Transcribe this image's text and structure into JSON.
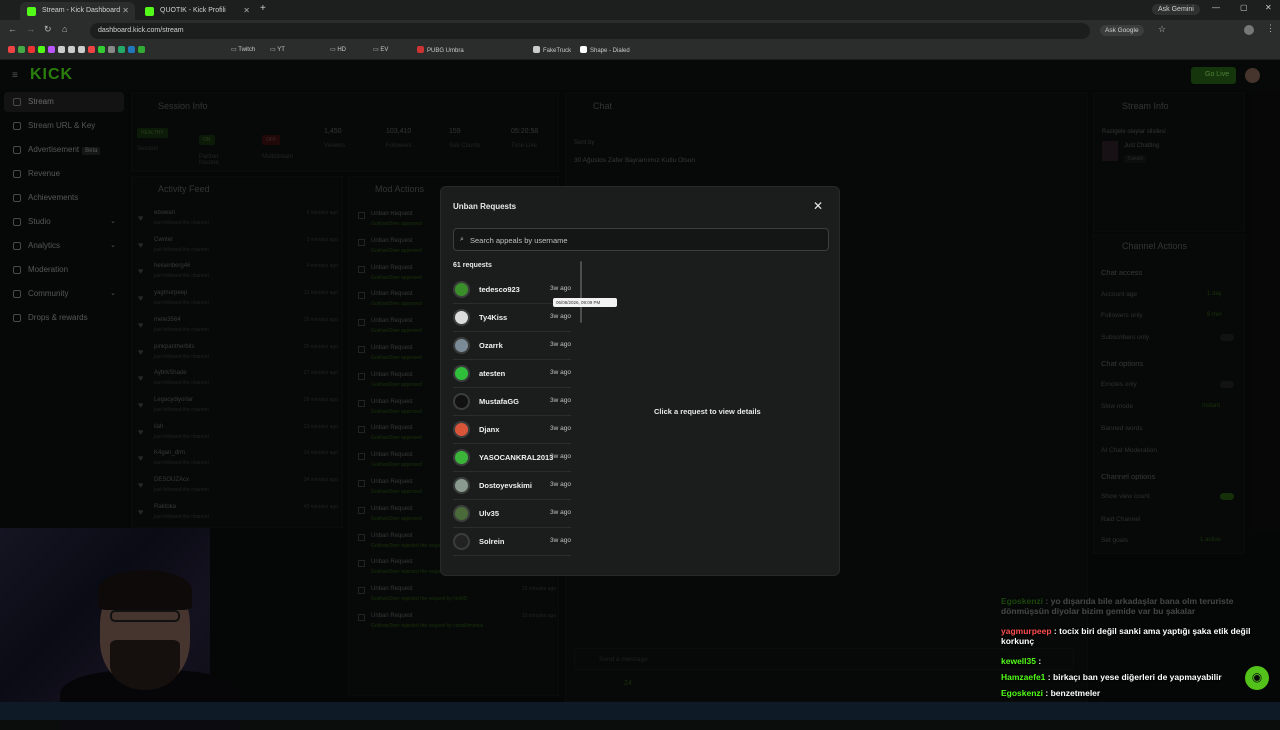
{
  "browser": {
    "tabs": [
      {
        "label": "Stream - Kick Dashboard",
        "active": true
      },
      {
        "label": "QUOTIK - Kick Profili",
        "active": false
      }
    ],
    "gemini": "Ask Gemini",
    "url": "dashboard.kick.com/stream",
    "ask_google": "Ask Google",
    "bookmarks": [
      "Twitch",
      "YT",
      "HD",
      "EV",
      "PUBG Umbra",
      "FakeTruck",
      "Shape - Dialed"
    ]
  },
  "kick": {
    "logo": "KICK",
    "go_live": "Go Live"
  },
  "sidebar": {
    "items": [
      {
        "label": "Stream",
        "active": true
      },
      {
        "label": "Stream URL & Key"
      },
      {
        "label": "Advertisement",
        "badge": "Beta"
      },
      {
        "label": "Revenue"
      },
      {
        "label": "Achievements"
      },
      {
        "label": "Studio"
      },
      {
        "label": "Analytics"
      },
      {
        "label": "Moderation"
      },
      {
        "label": "Community"
      },
      {
        "label": "Drops & rewards"
      }
    ]
  },
  "session": {
    "title": "Session Info",
    "stats": [
      {
        "value": "HEALTHY",
        "label": "Session"
      },
      {
        "value": "ON",
        "label": "Partner Income"
      },
      {
        "value": "OFF",
        "label": "Multistream"
      },
      {
        "value": "1,450",
        "label": "Viewers"
      },
      {
        "value": "103,410",
        "label": "Followers"
      },
      {
        "value": "159",
        "label": "Sub Counts"
      },
      {
        "value": "05:20:58",
        "label": "Time Live"
      }
    ]
  },
  "activity": {
    "title": "Activity Feed",
    "sub": "just followed the channel",
    "rows": [
      {
        "name": "ebowan",
        "time": "2 minutes ago"
      },
      {
        "name": "Cwnter",
        "time": "3 minutes ago"
      },
      {
        "name": "heisenberg46",
        "time": "4 minutes ago"
      },
      {
        "name": "yagmurpeep",
        "time": "12 minutes ago"
      },
      {
        "name": "mete3564",
        "time": "15 minutes ago"
      },
      {
        "name": "pinkpantherbitc",
        "time": "25 minutes ago"
      },
      {
        "name": "AybrkShade",
        "time": "27 minutes ago"
      },
      {
        "name": "Legacydiyorlar",
        "time": "28 minutes ago"
      },
      {
        "name": "ilah",
        "time": "33 minutes ago"
      },
      {
        "name": "K4gan_drm",
        "time": "34 minutes ago"
      },
      {
        "name": "DESOUZAcx",
        "time": "34 minutes ago"
      },
      {
        "name": "Raktoka",
        "time": "40 minutes ago"
      }
    ]
  },
  "mod_actions": {
    "title": "Mod Actions",
    "rows": [
      {
        "name": "Unban Request",
        "sub": "GokhanOner approved",
        "time": ""
      },
      {
        "name": "Unban Request",
        "sub": "GokhanOner approved",
        "time": ""
      },
      {
        "name": "Unban Request",
        "sub": "GokhanOner approved",
        "time": ""
      },
      {
        "name": "Unban Request",
        "sub": "GokhanOner approved",
        "time": ""
      },
      {
        "name": "Unban Request",
        "sub": "GokhanOner approved",
        "time": ""
      },
      {
        "name": "Unban Request",
        "sub": "GokhanOner approved",
        "time": ""
      },
      {
        "name": "Unban Request",
        "sub": "GokhanOner approved",
        "time": ""
      },
      {
        "name": "Unban Request",
        "sub": "GokhanOner approved",
        "time": ""
      },
      {
        "name": "Unban Request",
        "sub": "GokhanOner approved",
        "time": ""
      },
      {
        "name": "Unban Request",
        "sub": "GokhanOner approved",
        "time": ""
      },
      {
        "name": "Unban Request",
        "sub": "GokhanOner approved",
        "time": ""
      },
      {
        "name": "Unban Request",
        "sub": "GokhanOner approved",
        "time": ""
      },
      {
        "name": "Unban Request",
        "sub": "GokhanOner rejected the request by ramiljunkieee",
        "time": "14 minutes ago"
      },
      {
        "name": "Unban Request",
        "sub": "GokhanOner rejected the request by dlasoctiandeywestern",
        "time": "14 minutes ago"
      },
      {
        "name": "Unban Request",
        "sub": "GokhanOner rejected the request by NoMD",
        "time": "16 minutes ago"
      },
      {
        "name": "Unban Request",
        "sub": "GokhanOner rejected the request by canbillimentis",
        "time": "16 minutes ago"
      }
    ]
  },
  "chat": {
    "title": "Chat",
    "pinned_by": "Sent by",
    "pinned_msg": "30 Ağustos Zafer Bayramımız Kutlu Olsun",
    "send_placeholder": "Send a message",
    "viewers": "24"
  },
  "stream_info": {
    "title": "Stream Info",
    "stream_title": "Rastgele olaylar silsilesi",
    "category": "Just Chatting",
    "tag": "Turkish"
  },
  "channel_actions": {
    "title": "Channel Actions",
    "chat_access": "Chat access",
    "account_age": {
      "label": "Account age",
      "value": "1 day"
    },
    "followers_only": {
      "label": "Followers only",
      "value": "6 min"
    },
    "subscribers_only": "Subscribers only",
    "chat_options": "Chat options",
    "emotes_only": "Emotes only",
    "slow_mode": {
      "label": "Slow mode",
      "value": "Instant"
    },
    "banned_words": "Banned words",
    "ai_moderation": "AI Chat Moderation",
    "channel_options": "Channel options",
    "show_view_count": "Show view count",
    "raid_channel": "Raid Channel",
    "set_goals": {
      "label": "Set goals",
      "value": "1 active"
    }
  },
  "modal": {
    "title": "Unban Requests",
    "search_placeholder": "Search appeals by username",
    "count": "61 requests",
    "detail_prompt": "Click a request to view details",
    "tooltip": "06/08/2026, 09:09 PM",
    "requests": [
      {
        "user": "tedesco923",
        "ago": "3w ago",
        "color": "#3a8f2a"
      },
      {
        "user": "Ty4Kiss",
        "ago": "3w ago",
        "color": "#dcdcdc"
      },
      {
        "user": "Ozarrk",
        "ago": "3w ago",
        "color": "#7a8a96"
      },
      {
        "user": "atesten",
        "ago": "3w ago",
        "color": "#2fbf3a"
      },
      {
        "user": "MustafaGG",
        "ago": "3w ago",
        "color": "#111111"
      },
      {
        "user": "Djanx",
        "ago": "3w ago",
        "color": "#d9553a"
      },
      {
        "user": "YASOCANKRAL2013",
        "ago": "3w ago",
        "color": "#3ab53a"
      },
      {
        "user": "Dostoyevskimi",
        "ago": "3w ago",
        "color": "#8a9a8e"
      },
      {
        "user": "Ulv35",
        "ago": "3w ago",
        "color": "#4a6a3a"
      },
      {
        "user": "Solrein",
        "ago": "3w ago",
        "color": "#222222"
      }
    ]
  },
  "overlay_chat": [
    {
      "name": "Egoskenzi",
      "text": "yo dışarıda bile arkadaşlar bana olm teruriste dönmüşsün diyolar bizim gemide var bu şakalar",
      "faded": true
    },
    {
      "name": "yagmurpeep",
      "text": "tocix biri değil sanki ama yaptığı şaka etik değil korkunç",
      "color": "#ff4d4d"
    },
    {
      "name": "kewell35",
      "text": "",
      "color": "#53fc18"
    },
    {
      "name": "Hamzaefe1",
      "text": "birkaçı ban yese diğerleri de yapmayabilir",
      "color": "#53fc18"
    },
    {
      "name": "Egoskenzi",
      "text": "benzetmeler",
      "color": "#53fc18"
    },
    {
      "name": "N0K1TA",
      "text": "normal biri pkkli birine benzetmez aq yoruma bak",
      "color": "#3b82f6"
    }
  ]
}
